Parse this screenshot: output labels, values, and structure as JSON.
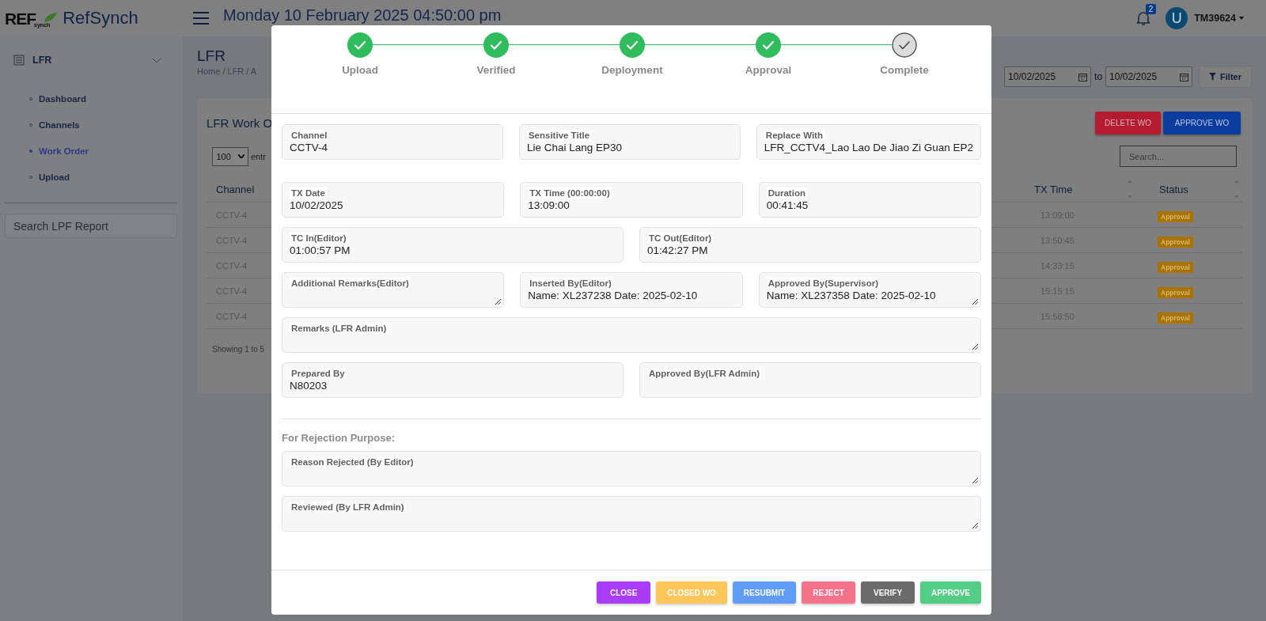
{
  "header": {
    "logo_mark": "REF",
    "logo_sub": "synch",
    "app_name": "RefSynch",
    "datetime": "Monday 10 February 2025 04:50:00 pm",
    "notifications": "2",
    "avatar_initial": "U",
    "username": "TM39624"
  },
  "sidebar": {
    "section": {
      "label": "LFR",
      "expanded": true
    },
    "items": [
      {
        "label": "Dashboard",
        "selected": false
      },
      {
        "label": "Channels",
        "selected": false
      },
      {
        "label": "Work Order",
        "selected": true
      },
      {
        "label": "Upload",
        "selected": false
      }
    ],
    "search": {
      "placeholder": "Search LPF Report"
    }
  },
  "page": {
    "title": "LFR",
    "breadcrumb": "Home / LFR / A",
    "date_from": "10/02/2025",
    "date_to_label": "to",
    "date_to": "10/02/2025",
    "filter_button": "Filter"
  },
  "card": {
    "title": "LFR Work O",
    "buttons": [
      {
        "label": "DELETE WO",
        "color": "#b51b30"
      },
      {
        "label": "APPROVE WO",
        "color": "#0c3d9e"
      }
    ],
    "page_size": "100",
    "entries_label": "entr",
    "search": {
      "placeholder": "Search..."
    },
    "columns": [
      "Channel",
      "TX Time",
      "Status"
    ],
    "rows": [
      {
        "channel": "CCTV-4",
        "tx_time": "13:09:00",
        "status": "Approval"
      },
      {
        "channel": "CCTV-4",
        "tx_time": "13:50:45",
        "status": "Approval"
      },
      {
        "channel": "CCTV-4",
        "tx_time": "14:33:15",
        "status": "Approval"
      },
      {
        "channel": "CCTV-4",
        "tx_time": "15:15:15",
        "status": "Approval"
      },
      {
        "channel": "CCTV-4",
        "tx_time": "15:58:50",
        "status": "Approval"
      }
    ],
    "footer": "Showing 1 to 5"
  },
  "modal": {
    "steps": [
      {
        "label": "Upload",
        "done": true
      },
      {
        "label": "Verified",
        "done": true
      },
      {
        "label": "Deployment",
        "done": true
      },
      {
        "label": "Approval",
        "done": true
      },
      {
        "label": "Complete",
        "done": false
      }
    ],
    "field_rows": [
      [
        {
          "label": "Channel",
          "value": "CCTV-4",
          "kind": "input"
        },
        {
          "label": "Sensitive Title",
          "value": "Lie Chai Lang EP30",
          "kind": "input"
        },
        {
          "label": "Replace With",
          "value": "LFR_CCTV4_Lao Lao De Jiao Zi Guan EP2",
          "kind": "input"
        }
      ],
      [
        {
          "label": "TX Date",
          "value": "10/02/2025",
          "kind": "input"
        },
        {
          "label": "TX Time (00:00:00)",
          "value": "13:09:00",
          "kind": "input"
        },
        {
          "label": "Duration",
          "value": "00:41:45",
          "kind": "input"
        }
      ],
      [
        {
          "label": "TC In(Editor)",
          "value": "01:00:57 PM",
          "kind": "input"
        },
        {
          "label": "TC Out(Editor)",
          "value": "01:42:27 PM",
          "kind": "input"
        }
      ],
      [
        {
          "label": "Additional Remarks(Editor)",
          "kind": "textarea"
        },
        {
          "label": "Inserted By(Editor)",
          "value": "Name: XL237238 Date: 2025-02-10",
          "kind": "input"
        },
        {
          "label": "Approved By(Supervisor)",
          "value": "Name: XL237358 Date: 2025-02-10",
          "kind": "textarea"
        }
      ],
      [
        {
          "label": "Remarks (LFR Admin)",
          "kind": "textarea"
        }
      ],
      [
        {
          "label": "Prepared By",
          "value": "N80203",
          "kind": "input"
        },
        {
          "label": "Approved By(LFR Admin)",
          "kind": "input"
        }
      ]
    ],
    "rejection_heading": "For Rejection Purpose:",
    "rejection_fields": [
      {
        "label": "Reason Rejected (By Editor)",
        "kind": "textarea"
      },
      {
        "label": "Reviewed (By LFR Admin)",
        "kind": "textarea"
      }
    ],
    "buttons": [
      {
        "label": "CLOSE",
        "color": "#a93cf6"
      },
      {
        "label": "CLOSED WO",
        "color": "#ffc65a"
      },
      {
        "label": "RESUBMIT",
        "color": "#5e9cf6"
      },
      {
        "label": "REJECT",
        "color": "#f6728a"
      },
      {
        "label": "VERIFY",
        "color": "#6b6b6b"
      },
      {
        "label": "APPROVE",
        "color": "#53cd86"
      }
    ]
  }
}
